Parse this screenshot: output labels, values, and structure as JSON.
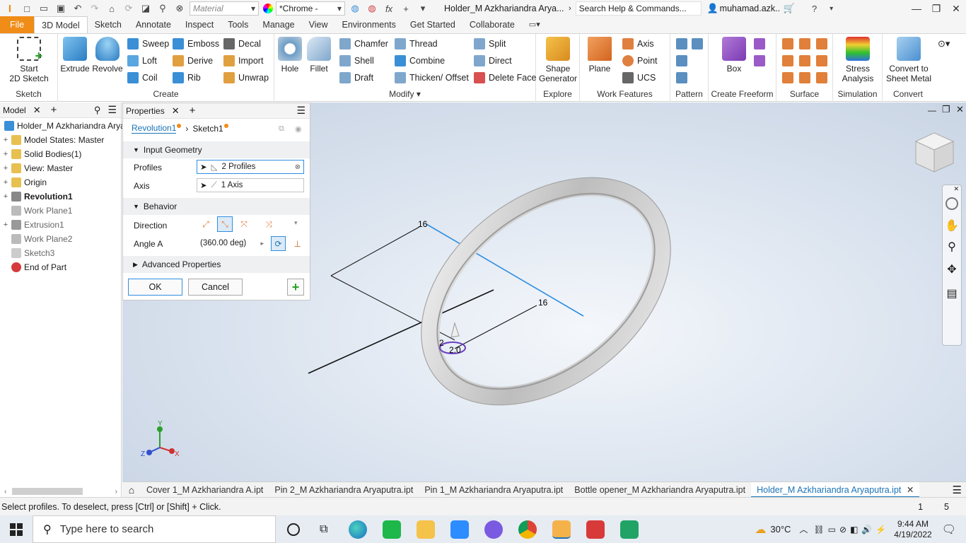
{
  "titlebar": {
    "material": "Material",
    "appearance": "*Chrome -",
    "doc_title": "Holder_M Azkhariandra Arya...",
    "search_placeholder": "Search Help & Commands...",
    "user": "muhamad.azk..."
  },
  "ribbon_tabs": [
    "File",
    "3D Model",
    "Sketch",
    "Annotate",
    "Inspect",
    "Tools",
    "Manage",
    "View",
    "Environments",
    "Get Started",
    "Collaborate"
  ],
  "ribbon": {
    "sketch": {
      "start": "Start",
      "start2": "2D Sketch",
      "label": "Sketch"
    },
    "create": {
      "extrude": "Extrude",
      "revolve": "Revolve",
      "sweep": "Sweep",
      "loft": "Loft",
      "coil": "Coil",
      "emboss": "Emboss",
      "derive": "Derive",
      "rib": "Rib",
      "decal": "Decal",
      "import": "Import",
      "unwrap": "Unwrap",
      "label": "Create"
    },
    "modify": {
      "hole": "Hole",
      "fillet": "Fillet",
      "chamfer": "Chamfer",
      "shell": "Shell",
      "draft": "Draft",
      "thread": "Thread",
      "combine": "Combine",
      "thicken": "Thicken/ Offset",
      "split": "Split",
      "direct": "Direct",
      "delete_face": "Delete Face",
      "label": "Modify"
    },
    "explore": {
      "shape1": "Shape",
      "shape2": "Generator",
      "label": "Explore"
    },
    "work": {
      "plane": "Plane",
      "axis": "Axis",
      "point": "Point",
      "ucs": "UCS",
      "label": "Work Features"
    },
    "pattern": {
      "label": "Pattern"
    },
    "freeform": {
      "box": "Box",
      "label": "Create Freeform"
    },
    "surface": {
      "label": "Surface"
    },
    "simulation": {
      "stress1": "Stress",
      "stress2": "Analysis",
      "label": "Simulation"
    },
    "convert": {
      "conv1": "Convert to",
      "conv2": "Sheet Metal",
      "label": "Convert"
    }
  },
  "model_panel": {
    "tab_model": "Model",
    "items": [
      {
        "label": "Holder_M Azkhariandra Aryaputra",
        "color": "#3a8fd6",
        "expander": ""
      },
      {
        "label": "Model States: Master",
        "color": "#e8c050",
        "expander": "+"
      },
      {
        "label": "Solid Bodies(1)",
        "color": "#e8c050",
        "expander": "+"
      },
      {
        "label": "View: Master",
        "color": "#e8c050",
        "expander": "+"
      },
      {
        "label": "Origin",
        "color": "#e8c050",
        "expander": "+"
      },
      {
        "label": "Revolution1",
        "color": "#888888",
        "expander": "+"
      },
      {
        "label": "Work Plane1",
        "color": "#bbbbbb",
        "expander": ""
      },
      {
        "label": "Extrusion1",
        "color": "#999999",
        "expander": "+"
      },
      {
        "label": "Work Plane2",
        "color": "#bbbbbb",
        "expander": ""
      },
      {
        "label": "Sketch3",
        "color": "#cccccc",
        "expander": ""
      },
      {
        "label": "End of Part",
        "color": "#d63a3a",
        "expander": ""
      }
    ]
  },
  "properties": {
    "tab": "Properties",
    "breadcrumb1": "Revolution1",
    "breadcrumb2": "Sketch1",
    "input_geometry": "Input Geometry",
    "profiles_label": "Profiles",
    "profiles_value": "2 Profiles",
    "axis_label": "Axis",
    "axis_value": "1 Axis",
    "behavior": "Behavior",
    "direction_label": "Direction",
    "angle_label": "Angle A",
    "angle_value": "(360.00 deg)",
    "advanced": "Advanced Properties",
    "ok": "OK",
    "cancel": "Cancel"
  },
  "viewport": {
    "dim_a": "16",
    "dim_b": "16",
    "dim_c": "2.0",
    "dim_d": "2"
  },
  "doc_tabs": [
    "Cover 1_M Azkhariandra A.ipt",
    "Pin 2_M Azkhariandra Aryaputra.ipt",
    "Pin 1_M Azkhariandra Aryaputra.ipt",
    "Bottle opener_M Azkhariandra Aryaputra.ipt",
    "Holder_M Azkhariandra Aryaputra.ipt"
  ],
  "status": {
    "text": "Select profiles. To deselect, press [Ctrl] or [Shift] + Click.",
    "n1": "1",
    "n2": "5"
  },
  "taskbar": {
    "search_placeholder": "Type here to search",
    "temp": "30°C",
    "time": "9:44 AM",
    "date": "4/19/2022"
  }
}
